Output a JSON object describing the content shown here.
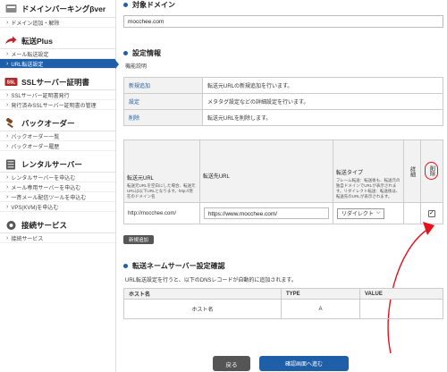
{
  "sidebar": {
    "domain_head": "ドメインバーキングβver",
    "domain_items": [
      "ドメイン追加・解除"
    ],
    "transfer_head": "転送Plus",
    "transfer_items": [
      "メール転送設定",
      "URL転送設定"
    ],
    "ssl_head": "SSLサーバー証明書",
    "ssl_items": [
      "SSLサーバー証明書発行",
      "発行済みSSLサーバー証明書の管理"
    ],
    "backorder_head": "バックオーダー",
    "backorder_items": [
      "バックオーダー一覧",
      "バックオーダー履歴"
    ],
    "rental_head": "レンタルサーバー",
    "rental_items": [
      "レンタルサーバーを申込む",
      "メール専用サーバーを申込む",
      "一斉メール配信ツールを申込む",
      "VPS(KVM)を申込む"
    ],
    "service_head": "接続サービス",
    "service_items": [
      "接続サービス"
    ]
  },
  "target_domain": {
    "title": "対象ドメイン",
    "value": "mocchee.com"
  },
  "settings": {
    "title": "設定情報",
    "desc_label": "機能説明",
    "functions": [
      {
        "key": "新規追加",
        "desc": "転送元URLの新規追加を行います。"
      },
      {
        "key": "設定",
        "desc": "メタタグ設定などの詳細設定を行います。"
      },
      {
        "key": "削除",
        "desc": "転送元URLを削除します。"
      }
    ]
  },
  "mapping": {
    "col_source": "転送元URL",
    "col_source_note": "転送元URLを空白にした場合、転送元URLは以下URLとなります。http://現在のドメイン名",
    "col_dest": "転送先URL",
    "col_type": "転送タイプ",
    "col_type_note": "フレーム転送：転送後も、転送元の独自ドメインでURLが表示されます。リダイレクト転送：転送後は、転送先のURLが表示されます。",
    "col_detail": "詳細",
    "col_delete": "削除",
    "row": {
      "source": "http://mocchee.com/",
      "dest": "https://www.mocchee.com/",
      "type": "リダイレクト",
      "delete_checked": true
    },
    "add_button": "新規追加"
  },
  "dns": {
    "title": "転送ネームサーバー設定確認",
    "note": "URL転送設定を行うと、以下のDNSレコードが自動的に追加されます。",
    "headers": [
      "ホスト名",
      "TYPE",
      "VALUE"
    ],
    "row": [
      "ホスト名",
      "A",
      ""
    ]
  },
  "footer": {
    "back_label": "戻る",
    "confirm_label": "確認画面へ進む"
  },
  "colors": {
    "accent": "#1f5fa8",
    "highlight": "#e8101a"
  }
}
